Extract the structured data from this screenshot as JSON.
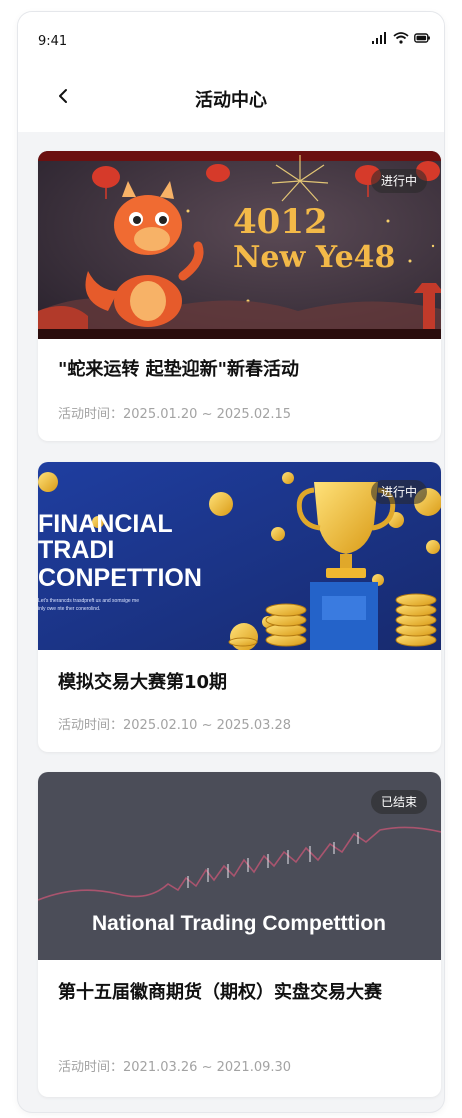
{
  "status_bar": {
    "time": "9:41"
  },
  "nav": {
    "title": "活动中心"
  },
  "activities": [
    {
      "status": "进行中",
      "title": "\"蛇来运转 起垫迎新\"新春活动",
      "time_label": "活动时间：",
      "time_range": "2025.01.20 ~ 2025.02.15",
      "banner": {
        "line1": "4012",
        "line2": "New Ye48"
      }
    },
    {
      "status": "进行中",
      "title": "模拟交易大赛第10期",
      "time_label": "活动时间：",
      "time_range": "2025.02.10 ~ 2025.03.28",
      "banner": {
        "line1": "FINANCIAL",
        "line2": "TRADI",
        "line3": "CONPETTION",
        "small1": "Let's therancds trasdpreft us and somsige me",
        "small2": "inly owe nte ther conerolind."
      }
    },
    {
      "status": "已结束",
      "title": "第十五届徽商期货（期权）实盘交易大赛",
      "time_label": "活动时间：",
      "time_range": "2021.03.26 ~ 2021.09.30",
      "banner": {
        "line1": "National Trading Competttion"
      }
    }
  ],
  "colors": {
    "accent_red": "#b91c1c",
    "navy": "#1e3a8a",
    "gold": "#f4c430",
    "slate": "#4b4d58"
  }
}
